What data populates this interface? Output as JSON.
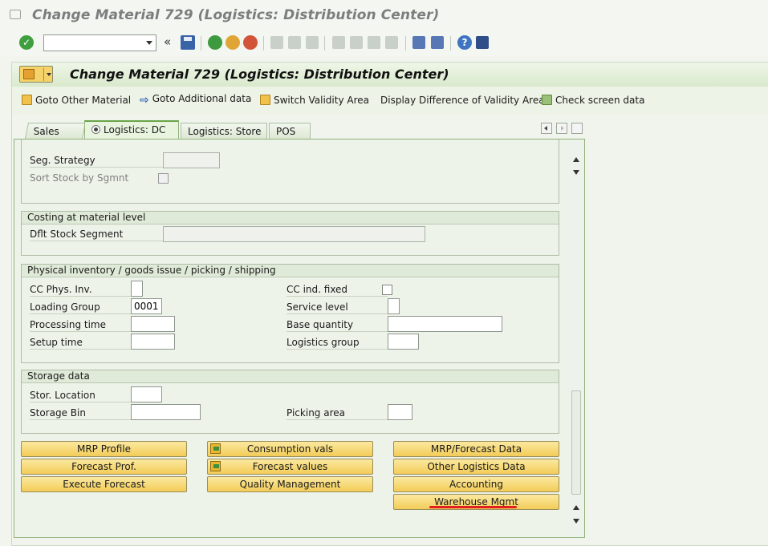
{
  "window": {
    "title": "Change Material 729 (Logistics: Distribution Center)"
  },
  "toolbar": {
    "command_value": "",
    "enter_icon": "check-icon"
  },
  "header": {
    "title": "Change Material 729 (Logistics: Distribution Center)"
  },
  "app_toolbar": {
    "items": [
      {
        "label": "Goto Other Material",
        "icon": "document-icon"
      },
      {
        "label": "Goto Additional data",
        "icon": "arrow-right-icon"
      },
      {
        "label": "Switch Validity Area",
        "icon": "document-icon"
      },
      {
        "label": "Display Difference of Validity Areas",
        "icon": ""
      },
      {
        "label": "Check screen data",
        "icon": "check-data-icon"
      }
    ]
  },
  "tabs": [
    {
      "label": "Sales",
      "active": false
    },
    {
      "label": "Logistics: DC",
      "active": true
    },
    {
      "label": "Logistics: Store",
      "active": false
    },
    {
      "label": "POS",
      "active": false
    }
  ],
  "seg": {
    "seg_strategy_label": "Seg. Strategy",
    "seg_strategy_value": "",
    "sort_stock_label": "Sort Stock by Sgmnt"
  },
  "costing": {
    "title": "Costing at material level",
    "dflt_stock_segment_label": "Dflt Stock Segment",
    "dflt_stock_segment_value": ""
  },
  "physical": {
    "title": "Physical inventory / goods issue / picking / shipping",
    "cc_phys_inv_label": "CC Phys. Inv.",
    "cc_phys_inv_value": "",
    "cc_ind_fixed_label": "CC ind. fixed",
    "loading_group_label": "Loading Group",
    "loading_group_value": "0001",
    "service_level_label": "Service level",
    "service_level_value": "",
    "processing_time_label": "Processing time",
    "processing_time_value": "",
    "base_quantity_label": "Base quantity",
    "base_quantity_value": "",
    "setup_time_label": "Setup time",
    "setup_time_value": "",
    "logistics_group_label": "Logistics group",
    "logistics_group_value": ""
  },
  "storage": {
    "title": "Storage data",
    "stor_location_label": "Stor. Location",
    "stor_location_value": "",
    "storage_bin_label": "Storage Bin",
    "storage_bin_value": "",
    "picking_area_label": "Picking area",
    "picking_area_value": ""
  },
  "buttons": {
    "mrp_profile": "MRP Profile",
    "forecast_prof": "Forecast Prof.",
    "execute_forecast": "Execute Forecast",
    "consumption_vals": "Consumption vals",
    "forecast_values": "Forecast values",
    "quality_management": "Quality Management",
    "mrp_forecast_data": "MRP/Forecast Data",
    "other_logistics_data": "Other Logistics Data",
    "accounting": "Accounting",
    "warehouse_mgmt": "Warehouse Mgmt"
  },
  "colors": {
    "accent_green": "#6aa44a",
    "button_yellow": "#f3cc58",
    "highlight_red": "#e02020"
  }
}
